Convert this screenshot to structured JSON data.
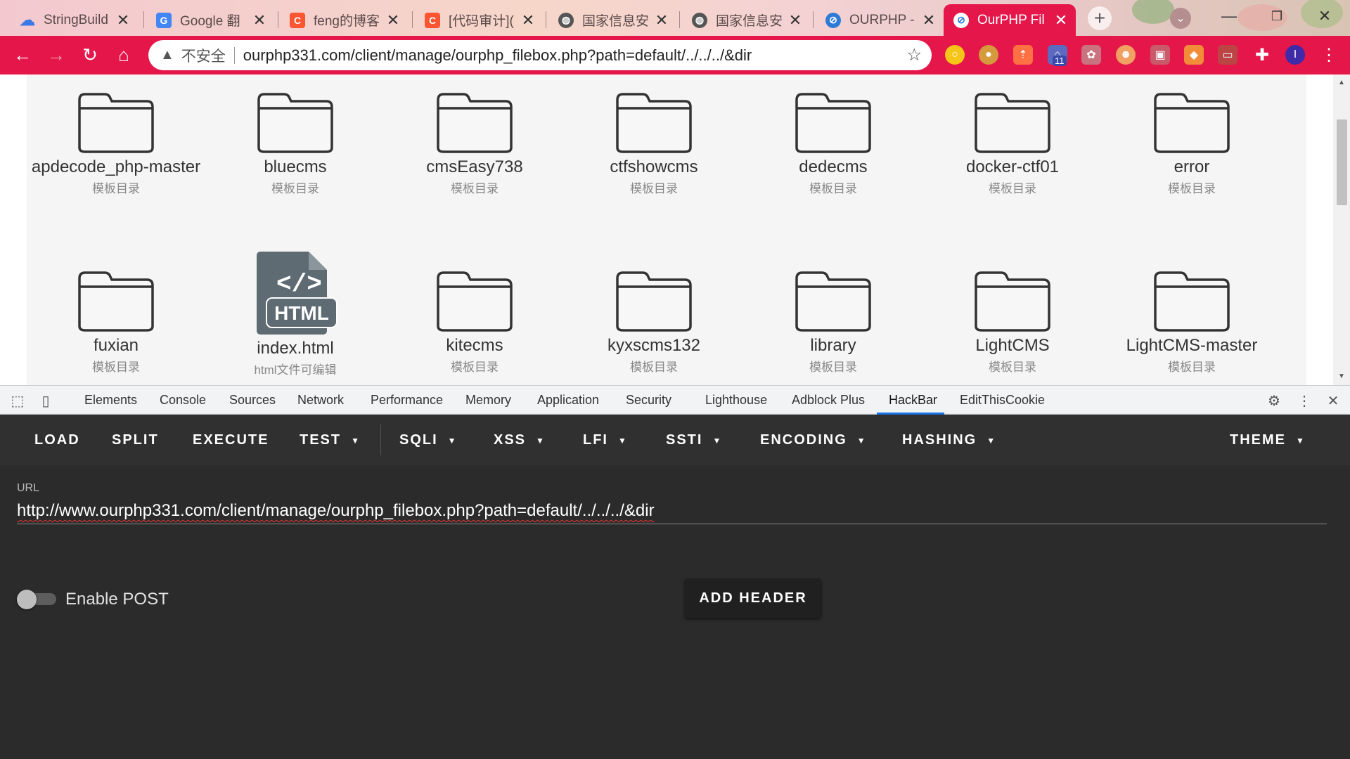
{
  "colors": {
    "accent": "#e5164a",
    "panel_dark": "#2b2b2b",
    "menu_dark": "#303030",
    "active_tab_line": "#1a73e8"
  },
  "browser": {
    "tabs": [
      {
        "title": "StringBuild",
        "icon": "cloud-icon"
      },
      {
        "title": "Google 翻",
        "icon": "google-translate-icon"
      },
      {
        "title": "feng的博客",
        "icon": "csdn-icon"
      },
      {
        "title": "[代码审计](",
        "icon": "csdn-icon"
      },
      {
        "title": "国家信息安",
        "icon": "globe-icon"
      },
      {
        "title": "国家信息安",
        "icon": "globe-icon"
      },
      {
        "title": "OURPHP -",
        "icon": "ourphp-icon"
      },
      {
        "title": "OurPHP Fil",
        "icon": "ourphp-icon",
        "active": true
      }
    ],
    "insecure_label": "不安全",
    "address": "ourphp331.com/client/manage/ourphp_filebox.php?path=default/../../../&dir",
    "ext_badge": "11",
    "profile_initial": "I"
  },
  "files": [
    {
      "name": "apdecode_php-master",
      "type": "模板目录",
      "kind": "folder"
    },
    {
      "name": "bluecms",
      "type": "模板目录",
      "kind": "folder"
    },
    {
      "name": "cmsEasy738",
      "type": "模板目录",
      "kind": "folder"
    },
    {
      "name": "ctfshowcms",
      "type": "模板目录",
      "kind": "folder"
    },
    {
      "name": "dedecms",
      "type": "模板目录",
      "kind": "folder"
    },
    {
      "name": "docker-ctf01",
      "type": "模板目录",
      "kind": "folder"
    },
    {
      "name": "error",
      "type": "模板目录",
      "kind": "folder"
    },
    {
      "name": "fuxian",
      "type": "模板目录",
      "kind": "folder"
    },
    {
      "name": "index.html",
      "type": "html文件可编辑",
      "kind": "html",
      "badge": "HTML"
    },
    {
      "name": "kitecms",
      "type": "模板目录",
      "kind": "folder"
    },
    {
      "name": "kyxscms132",
      "type": "模板目录",
      "kind": "folder"
    },
    {
      "name": "library",
      "type": "模板目录",
      "kind": "folder"
    },
    {
      "name": "LightCMS",
      "type": "模板目录",
      "kind": "folder"
    },
    {
      "name": "LightCMS-master",
      "type": "模板目录",
      "kind": "folder"
    }
  ],
  "devtools": {
    "tabs": [
      "Elements",
      "Console",
      "Sources",
      "Network",
      "Performance",
      "Memory",
      "Application",
      "Security",
      "Lighthouse",
      "Adblock Plus",
      "HackBar",
      "EditThisCookie"
    ],
    "active_tab": "HackBar"
  },
  "hackbar": {
    "menu": [
      {
        "label": "LOAD",
        "dropdown": false
      },
      {
        "label": "SPLIT",
        "dropdown": false
      },
      {
        "label": "EXECUTE",
        "dropdown": false
      },
      {
        "label": "TEST",
        "dropdown": true
      },
      {
        "label": "SQLI",
        "dropdown": true
      },
      {
        "label": "XSS",
        "dropdown": true
      },
      {
        "label": "LFI",
        "dropdown": true
      },
      {
        "label": "SSTI",
        "dropdown": true
      },
      {
        "label": "ENCODING",
        "dropdown": true
      },
      {
        "label": "HASHING",
        "dropdown": true
      },
      {
        "label": "THEME",
        "dropdown": true
      }
    ],
    "url_label": "URL",
    "url_value": "http://www.ourphp331.com/client/manage/ourphp_filebox.php?path=default/../../../&dir",
    "enable_post_label": "Enable POST",
    "enable_post": false,
    "add_header_label": "ADD HEADER"
  }
}
